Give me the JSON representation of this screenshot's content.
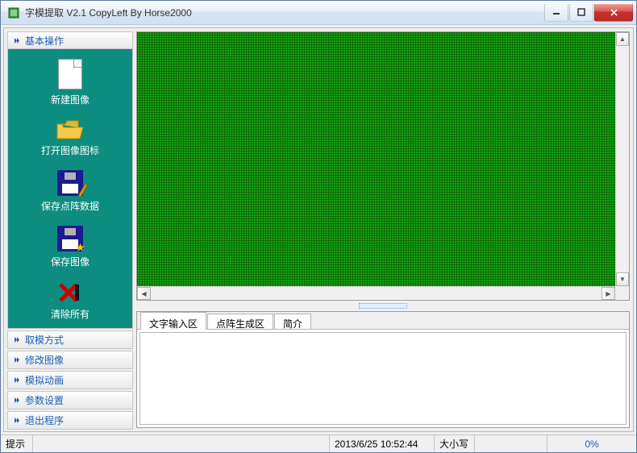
{
  "window": {
    "title": "字模提取 V2.1  CopyLeft By Horse2000"
  },
  "sidebar": {
    "panels": [
      {
        "label": "基本操作"
      },
      {
        "label": "取模方式"
      },
      {
        "label": "修改图像"
      },
      {
        "label": "模拟动画"
      },
      {
        "label": "参数设置"
      },
      {
        "label": "退出程序"
      }
    ],
    "items": [
      {
        "label": "新建图像"
      },
      {
        "label": "打开图像图标"
      },
      {
        "label": "保存点阵数据"
      },
      {
        "label": "保存图像"
      },
      {
        "label": "清除所有"
      }
    ]
  },
  "tabs": [
    {
      "label": "文字输入区",
      "active": true
    },
    {
      "label": "点阵生成区",
      "active": false
    },
    {
      "label": "简介",
      "active": false
    }
  ],
  "statusbar": {
    "hint": "提示",
    "datetime": "2013/6/25 10:52:44",
    "caps": "大小写",
    "progress": "0%"
  }
}
